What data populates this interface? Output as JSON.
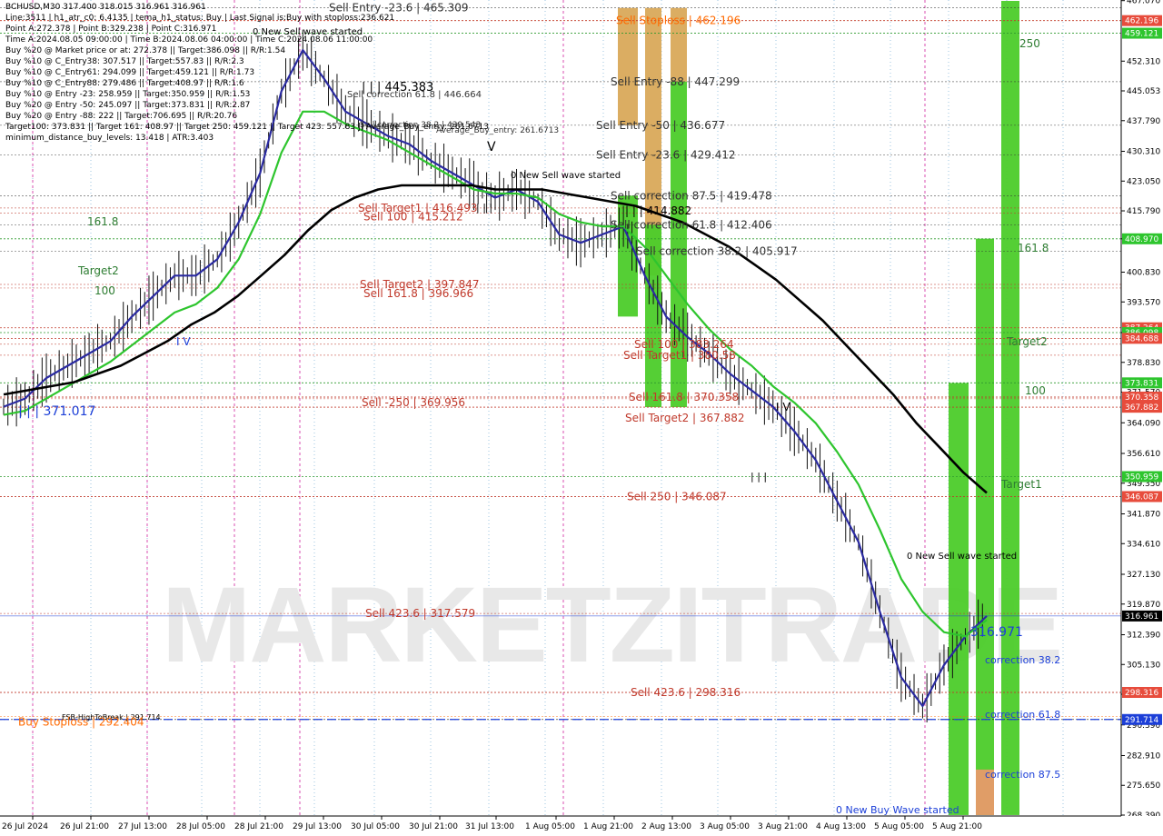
{
  "header_lines": [
    "BCHUSD,M30  317.400 318.015 316.961 316.961",
    "Line:3511  |  h1_atr_c0: 6.4135  |  tema_h1_status: Buy  |  Last Signal is:Buy with stoploss:236.621",
    "Point A:272.378  |  Point B:329.238  |  Point C:316.971",
    "Time A:2024.08.05 09:00:00  |  Time B:2024.08.06 04:00:00  |  Time C:2024.08.06 11:00:00",
    "Buy %20 @ Market price or at: 272.378  ||  Target:386.098  ||  R/R:1.54",
    "Buy %10 @ C_Entry38: 307.517  ||  Target:557.83  ||  R/R:2.3",
    "Buy %10 @ C_Entry61: 294.099  ||  Target:459.121  ||  R/R:1.73",
    "Buy %10 @ C_Entry88: 279.486  ||  Target:408.97  ||  R/R:1.6",
    "Buy %10 @ Entry -23: 258.959  ||  Target:350.959  ||  R/R:1.53",
    "Buy %20 @ Entry -50: 245.097  ||  Target:373.831  ||  R/R:2.87",
    "Buy %20 @ Entry -88: 222  ||  Target:706.695  ||  R/R:20.76",
    "Target100: 373.831  ||  Target 161: 408.97  ||  Target 250: 459.121  ||  Target 423: 557.83  ||  Average_Buy_entry: 261.6713",
    "minimum_distance_buy_levels: 13.418  |  ATR:3.403"
  ],
  "watermark": "MARKETZITRADE",
  "chart_data": {
    "type": "line",
    "symbol": "BCHUSD",
    "timeframe": "M30",
    "ylim": [
      268.39,
      467.0
    ],
    "y_ticks": [
      467.07,
      452.31,
      445.053,
      437.79,
      430.31,
      423.05,
      415.79,
      408.97,
      400.83,
      393.57,
      386.098,
      378.83,
      371.57,
      364.09,
      356.61,
      349.35,
      341.87,
      334.61,
      327.13,
      319.87,
      312.39,
      305.13,
      297.87,
      290.39,
      282.91,
      275.65,
      268.39
    ],
    "x_labels": [
      "26 Jul 2024",
      "26 Jul 21:00",
      "27 Jul 13:00",
      "28 Jul 05:00",
      "28 Jul 21:00",
      "29 Jul 13:00",
      "30 Jul 05:00",
      "30 Jul 21:00",
      "31 Jul 13:00",
      "1 Aug 05:00",
      "1 Aug 21:00",
      "2 Aug 13:00",
      "3 Aug 05:00",
      "3 Aug 21:00",
      "4 Aug 13:00",
      "5 Aug 05:00",
      "5 Aug 21:00"
    ],
    "current_price": 316.961,
    "series": [
      {
        "values": [
          368,
          370,
          375,
          378,
          381,
          384,
          390,
          395,
          400,
          400,
          404,
          413,
          425,
          445,
          455,
          448,
          440,
          437,
          434,
          432,
          428,
          425,
          422,
          419,
          421,
          418,
          410,
          408,
          410,
          412,
          400,
          390,
          385,
          381,
          376,
          372,
          368,
          362,
          355,
          345,
          335,
          318,
          302,
          295,
          305,
          312,
          316.961
        ],
        "color": "#2a2aa0"
      },
      {
        "values": [
          366,
          367,
          370,
          373,
          376,
          379,
          383,
          387,
          391,
          393,
          397,
          404,
          415,
          430,
          440,
          440,
          437,
          435,
          433,
          430,
          427,
          424,
          421,
          420,
          420,
          419,
          415,
          413,
          412,
          412,
          407,
          400,
          393,
          387,
          382,
          378,
          373,
          369,
          364,
          357,
          349,
          338,
          326,
          318,
          313,
          312,
          316
        ],
        "color": "#2ec52e"
      },
      {
        "values": [
          371,
          372,
          373,
          374,
          376,
          378,
          381,
          384,
          388,
          391,
          395,
          400,
          405,
          411,
          416,
          419,
          421,
          422,
          422,
          422,
          422,
          421,
          421,
          421,
          420,
          419,
          418,
          417,
          415,
          413,
          410,
          407,
          403,
          399,
          394,
          389,
          383,
          377,
          371,
          364,
          358,
          352,
          347
        ],
        "color": "#000000"
      }
    ],
    "levels": [
      {
        "label": "Sell Entry -23.6 | 465.309",
        "value": 465.309,
        "color": "#333333"
      },
      {
        "label": "Sell Stoploss | 462.196",
        "value": 462.196,
        "color": "#ff6a00"
      },
      {
        "label": "Sell Entry -88 | 447.299",
        "value": 447.299,
        "color": "#333333"
      },
      {
        "label": "Sell Entry -50 | 436.677",
        "value": 436.677,
        "color": "#333333"
      },
      {
        "label": "Sell Entry -23.6 | 429.412",
        "value": 429.412,
        "color": "#333333"
      },
      {
        "label": "Sell correction 87.5 | 419.478",
        "value": 419.478,
        "color": "#333333"
      },
      {
        "label": "Sell Target1 | 416.493",
        "value": 416.493,
        "color": "#c0392b"
      },
      {
        "label": "Sell 100 | 415.212",
        "value": 415.212,
        "color": "#c0392b"
      },
      {
        "label": "Sell correction 61.8 | 412.406",
        "value": 412.406,
        "color": "#333333"
      },
      {
        "label": "Sell correction 38.2 | 405.917",
        "value": 405.917,
        "color": "#333333"
      },
      {
        "label": "Sell Target2 | 397.847",
        "value": 397.847,
        "color": "#c0392b"
      },
      {
        "label": "Sell 161.8 | 396.966",
        "value": 396.966,
        "color": "#c0392b"
      },
      {
        "label": "Sell 100 | 383.264",
        "value": 383.264,
        "color": "#c0392b"
      },
      {
        "label": "Sell Target1 | 380.58",
        "value": 380.58,
        "color": "#c0392b"
      },
      {
        "label": "Sell 161.8 | 370.358",
        "value": 370.358,
        "color": "#c0392b"
      },
      {
        "label": "Sell -250 | 369.956",
        "value": 369.956,
        "color": "#c0392b"
      },
      {
        "label": "Sell Target2 | 367.882",
        "value": 367.882,
        "color": "#c0392b"
      },
      {
        "label": "Sell 250 | 346.087",
        "value": 346.087,
        "color": "#c0392b"
      },
      {
        "label": "Sell 423.6 | 317.579",
        "value": 317.579,
        "color": "#c0392b"
      },
      {
        "label": "Sell 423.6 | 298.316",
        "value": 298.316,
        "color": "#c0392b"
      },
      {
        "label": "FSB-HighToBreak | 291.714",
        "value": 291.714,
        "color": "#000000"
      },
      {
        "label": "Buy Stoploss | 292.404",
        "value": 292.404,
        "color": "#ff6a00"
      }
    ],
    "price_tags": [
      {
        "value": 462.196,
        "bg": "#e74c3c"
      },
      {
        "value": 459.121,
        "bg": "#2ec52e"
      },
      {
        "value": 408.97,
        "bg": "#2ec52e"
      },
      {
        "value": 387.264,
        "bg": "#e74c3c"
      },
      {
        "value": 386.098,
        "bg": "#2ec52e"
      },
      {
        "value": 384.688,
        "bg": "#e74c3c"
      },
      {
        "value": 373.831,
        "bg": "#2ec52e"
      },
      {
        "value": 370.358,
        "bg": "#e74c3c"
      },
      {
        "value": 367.882,
        "bg": "#e74c3c"
      },
      {
        "value": 350.959,
        "bg": "#2ec52e"
      },
      {
        "value": 346.087,
        "bg": "#e74c3c"
      },
      {
        "value": 316.961,
        "bg": "#000000"
      },
      {
        "value": 298.316,
        "bg": "#e74c3c"
      },
      {
        "value": 291.714,
        "bg": "#1c3fd8"
      }
    ],
    "annotations": [
      {
        "text": "0 New Sell wave started",
        "color": "#000000"
      },
      {
        "text": "| | | 445.383",
        "color": "#000000"
      },
      {
        "text": "Sell correction 61.8 | 446.664",
        "color": "#333333"
      },
      {
        "text": "Sell correction 38.2 | 439.543",
        "color": "#333333"
      },
      {
        "text": "Average_Buy_entry: 261.6713",
        "color": "#333333"
      },
      {
        "text": "0 New Sell wave started",
        "color": "#000000"
      },
      {
        "text": "| | | 414.882",
        "color": "#000000"
      },
      {
        "text": "161.8",
        "color": "#2e7d32"
      },
      {
        "text": "Target2",
        "color": "#2e7d32"
      },
      {
        "text": "100",
        "color": "#2e7d32"
      },
      {
        "text": "| | | 371.017",
        "color": "#1c3fd8"
      },
      {
        "text": "I V",
        "color": "#1c3fd8"
      },
      {
        "text": "I V",
        "color": "#000000"
      },
      {
        "text": "| | |",
        "color": "#000000"
      },
      {
        "text": "| | |",
        "color": "#000000"
      },
      {
        "text": "V",
        "color": "#000000"
      },
      {
        "text": "250",
        "color": "#2e7d32"
      },
      {
        "text": "161.8",
        "color": "#2e7d32"
      },
      {
        "text": "Target2",
        "color": "#2e7d32"
      },
      {
        "text": "100",
        "color": "#2e7d32"
      },
      {
        "text": "Target1",
        "color": "#2e7d32"
      },
      {
        "text": "0 New Sell wave started",
        "color": "#000000"
      },
      {
        "text": "316.971",
        "color": "#1c3fd8"
      },
      {
        "text": "correction 38.2",
        "color": "#1c3fd8"
      },
      {
        "text": "correction 61.8",
        "color": "#1c3fd8"
      },
      {
        "text": "correction 87.5",
        "color": "#1c3fd8"
      },
      {
        "text": "0 New Buy Wave started",
        "color": "#1c3fd8"
      }
    ]
  }
}
